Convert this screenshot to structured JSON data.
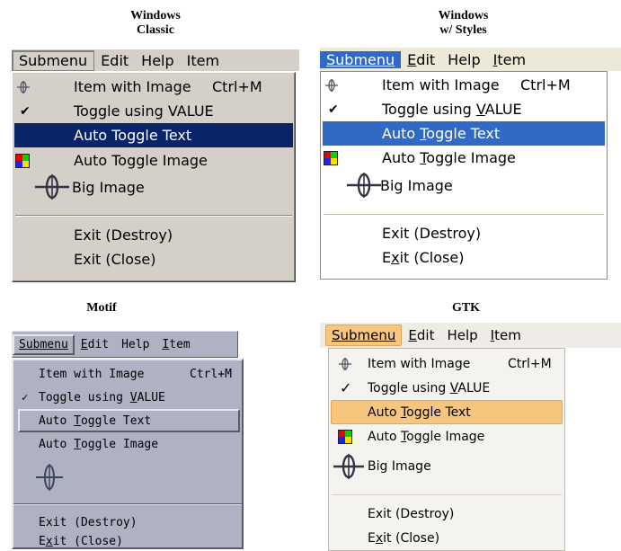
{
  "panels": {
    "classic": {
      "title_line1": "Windows",
      "title_line2": "Classic",
      "menubar": [
        "Submenu",
        "Edit",
        "Help",
        "Item"
      ],
      "items": {
        "item_with_image": "Item with Image",
        "item_with_image_accel": "Ctrl+M",
        "toggle_using_value": "Toggle using VALUE",
        "auto_toggle_text": "Auto Toggle Text",
        "auto_toggle_image": "Auto Toggle Image",
        "big_image": "Big Image",
        "exit_destroy": "Exit (Destroy)",
        "exit_close": "Exit (Close)"
      }
    },
    "styles": {
      "title_line1": "Windows",
      "title_line2": "w/ Styles",
      "menubar": [
        "Submenu",
        "Edit",
        "Help",
        "Item"
      ],
      "items": {
        "item_with_image": "Item with Image",
        "item_with_image_accel": "Ctrl+M",
        "toggle_pre": "Toggle using ",
        "toggle_u": "V",
        "toggle_post": "ALUE",
        "auto_text_pre": "Auto ",
        "auto_text_u": "T",
        "auto_text_post": "oggle Text",
        "auto_image_pre": "Auto ",
        "auto_image_u": "T",
        "auto_image_post": "oggle Image",
        "big_image": "Big Image",
        "exit_destroy": "Exit (Destroy)",
        "exit_close_pre": "E",
        "exit_close_u": "x",
        "exit_close_post": "it (Close)"
      }
    },
    "motif": {
      "title": "Motif",
      "menubar": [
        "Submenu",
        "Edit",
        "Help",
        "Item"
      ],
      "items": {
        "item_with_image": "Item with Image",
        "item_with_image_accel": "Ctrl+M",
        "toggle_pre": "Toggle using ",
        "toggle_u": "V",
        "toggle_post": "ALUE",
        "auto_text_pre": "Auto ",
        "auto_text_u": "T",
        "auto_text_post": "oggle Text",
        "auto_image_pre": "Auto ",
        "auto_image_u": "T",
        "auto_image_post": "oggle Image",
        "exit_destroy": "Exit (Destroy)",
        "exit_close_pre": "E",
        "exit_close_u": "x",
        "exit_close_post": "it (Close)"
      }
    },
    "gtk": {
      "title": "GTK",
      "menubar": [
        "Submenu",
        "Edit",
        "Help",
        "Item"
      ],
      "items": {
        "item_with_image": "Item with Image",
        "item_with_image_accel": "Ctrl+M",
        "toggle_pre": "Toggle using ",
        "toggle_u": "V",
        "toggle_post": "ALUE",
        "auto_text_pre": "Auto ",
        "auto_text_u": "T",
        "auto_text_post": "oggle Text",
        "auto_image_pre": "Auto ",
        "auto_image_u": "T",
        "auto_image_post": "oggle Image",
        "big_image": "Big Image",
        "exit_destroy": "Exit (Destroy)",
        "exit_close_pre": "E",
        "exit_close_u": "x",
        "exit_close_post": "it (Close)"
      }
    }
  },
  "colors": {
    "classic_menu_bg": "#d4d0c8",
    "classic_highlight": "#0a246a",
    "styles_highlight": "#316ac5",
    "motif_bg": "#aeb2c3",
    "gtk_highlight": "#f6c57e"
  },
  "icons": [
    "crosshair-icon",
    "checkmark-icon",
    "color-squares-icon",
    "big-crosshair-icon"
  ]
}
